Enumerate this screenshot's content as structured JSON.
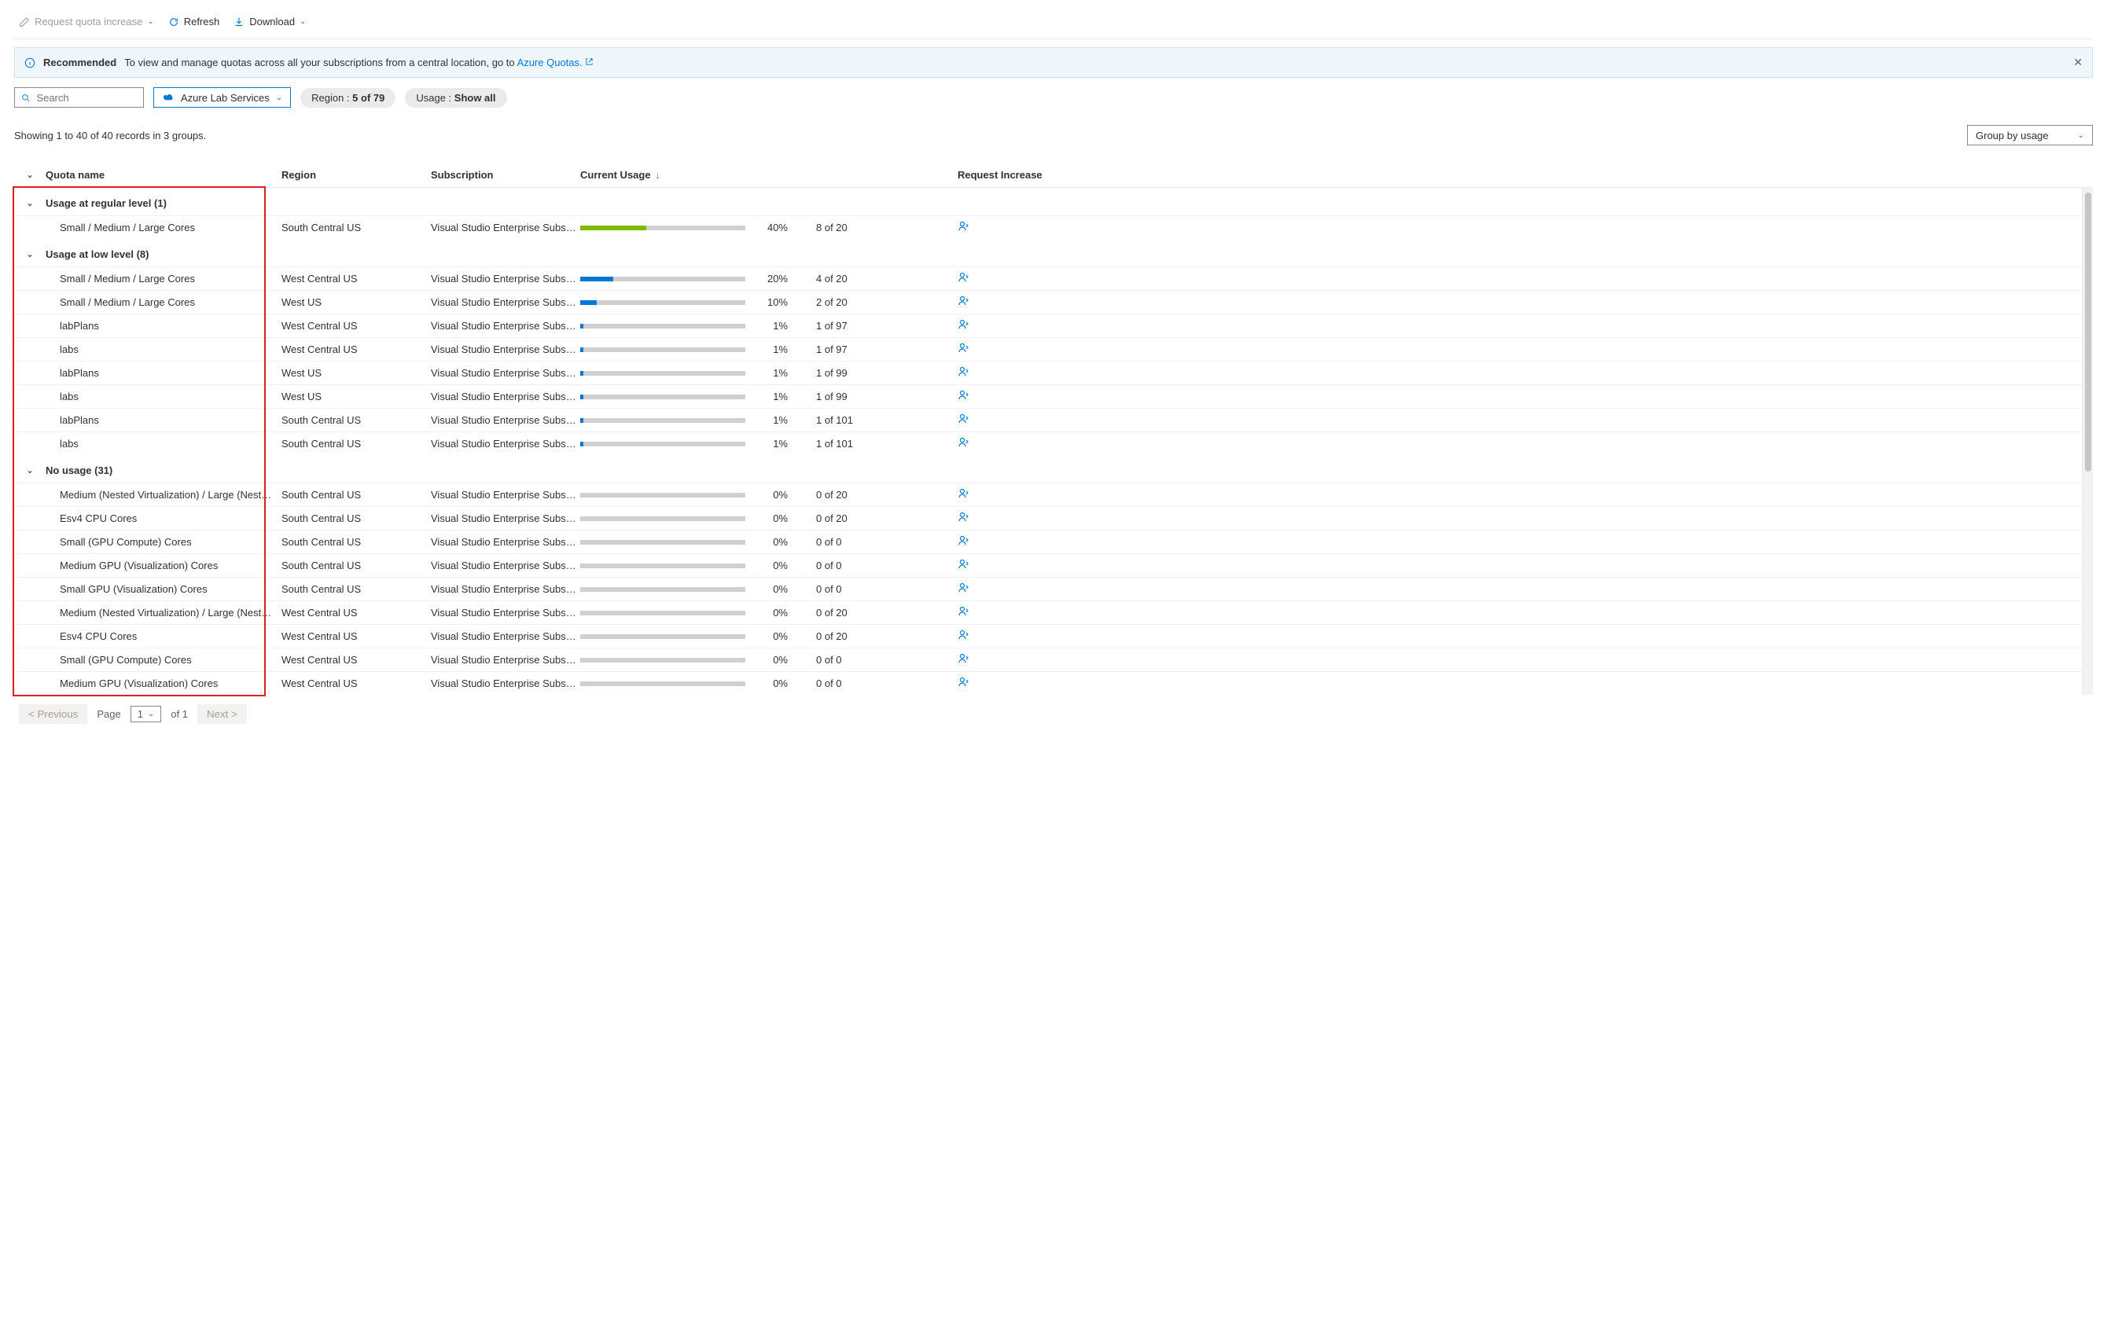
{
  "toolbar": {
    "request_increase": "Request quota increase",
    "refresh": "Refresh",
    "download": "Download"
  },
  "banner": {
    "recommended": "Recommended",
    "text": "To view and manage quotas across all your subscriptions from a central location, go to ",
    "link": "Azure Quotas."
  },
  "filters": {
    "search_placeholder": "Search",
    "provider": "Azure Lab Services",
    "region_label": "Region : ",
    "region_value": "5 of 79",
    "usage_label": "Usage : ",
    "usage_value": "Show all"
  },
  "summary": "Showing 1 to 40 of 40 records in 3 groups.",
  "group_by": "Group by usage",
  "columns": {
    "name": "Quota name",
    "region": "Region",
    "subscription": "Subscription",
    "usage": "Current Usage",
    "request": "Request Increase"
  },
  "groups": [
    {
      "title": "Usage at regular level (1)",
      "rows": [
        {
          "name": "Small / Medium / Large Cores",
          "region": "South Central US",
          "sub": "Visual Studio Enterprise Subscri…",
          "pct": 40,
          "count": "8 of 20",
          "color": "#7fba00"
        }
      ]
    },
    {
      "title": "Usage at low level (8)",
      "rows": [
        {
          "name": "Small / Medium / Large Cores",
          "region": "West Central US",
          "sub": "Visual Studio Enterprise Subscri…",
          "pct": 20,
          "count": "4 of 20",
          "color": "#0078d4"
        },
        {
          "name": "Small / Medium / Large Cores",
          "region": "West US",
          "sub": "Visual Studio Enterprise Subscri…",
          "pct": 10,
          "count": "2 of 20",
          "color": "#0078d4"
        },
        {
          "name": "labPlans",
          "region": "West Central US",
          "sub": "Visual Studio Enterprise Subscri…",
          "pct": 1,
          "count": "1 of 97",
          "color": "#0078d4"
        },
        {
          "name": "labs",
          "region": "West Central US",
          "sub": "Visual Studio Enterprise Subscri…",
          "pct": 1,
          "count": "1 of 97",
          "color": "#0078d4"
        },
        {
          "name": "labPlans",
          "region": "West US",
          "sub": "Visual Studio Enterprise Subscri…",
          "pct": 1,
          "count": "1 of 99",
          "color": "#0078d4"
        },
        {
          "name": "labs",
          "region": "West US",
          "sub": "Visual Studio Enterprise Subscri…",
          "pct": 1,
          "count": "1 of 99",
          "color": "#0078d4"
        },
        {
          "name": "labPlans",
          "region": "South Central US",
          "sub": "Visual Studio Enterprise Subscri…",
          "pct": 1,
          "count": "1 of 101",
          "color": "#0078d4"
        },
        {
          "name": "labs",
          "region": "South Central US",
          "sub": "Visual Studio Enterprise Subscri…",
          "pct": 1,
          "count": "1 of 101",
          "color": "#0078d4"
        }
      ]
    },
    {
      "title": "No usage (31)",
      "rows": [
        {
          "name": "Medium (Nested Virtualization) / Large (Nested …",
          "region": "South Central US",
          "sub": "Visual Studio Enterprise Subscri…",
          "pct": 0,
          "count": "0 of 20",
          "color": "#c8c6c4"
        },
        {
          "name": "Esv4 CPU Cores",
          "region": "South Central US",
          "sub": "Visual Studio Enterprise Subscri…",
          "pct": 0,
          "count": "0 of 20",
          "color": "#c8c6c4"
        },
        {
          "name": "Small (GPU Compute) Cores",
          "region": "South Central US",
          "sub": "Visual Studio Enterprise Subscri…",
          "pct": 0,
          "count": "0 of 0",
          "color": "#c8c6c4"
        },
        {
          "name": "Medium GPU (Visualization) Cores",
          "region": "South Central US",
          "sub": "Visual Studio Enterprise Subscri…",
          "pct": 0,
          "count": "0 of 0",
          "color": "#c8c6c4"
        },
        {
          "name": "Small GPU (Visualization) Cores",
          "region": "South Central US",
          "sub": "Visual Studio Enterprise Subscri…",
          "pct": 0,
          "count": "0 of 0",
          "color": "#c8c6c4"
        },
        {
          "name": "Medium (Nested Virtualization) / Large (Nested …",
          "region": "West Central US",
          "sub": "Visual Studio Enterprise Subscri…",
          "pct": 0,
          "count": "0 of 20",
          "color": "#c8c6c4"
        },
        {
          "name": "Esv4 CPU Cores",
          "region": "West Central US",
          "sub": "Visual Studio Enterprise Subscri…",
          "pct": 0,
          "count": "0 of 20",
          "color": "#c8c6c4"
        },
        {
          "name": "Small (GPU Compute) Cores",
          "region": "West Central US",
          "sub": "Visual Studio Enterprise Subscri…",
          "pct": 0,
          "count": "0 of 0",
          "color": "#c8c6c4"
        },
        {
          "name": "Medium GPU (Visualization) Cores",
          "region": "West Central US",
          "sub": "Visual Studio Enterprise Subscri…",
          "pct": 0,
          "count": "0 of 0",
          "color": "#c8c6c4"
        }
      ]
    }
  ],
  "pagination": {
    "previous": "< Previous",
    "page_label": "Page",
    "page_num": "1",
    "of": "of 1",
    "next": "Next >"
  }
}
